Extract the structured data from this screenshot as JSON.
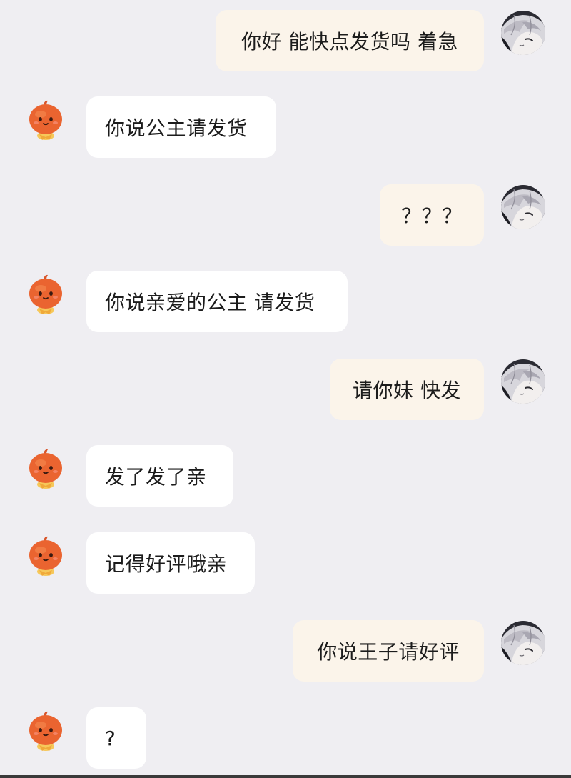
{
  "conversation": {
    "messages": [
      {
        "from": "customer",
        "text": "你好  能快点发货吗  着急",
        "avatar_icon": "anime-girl-avatar-icon"
      },
      {
        "from": "shop",
        "text": "你说公主请发货",
        "avatar_icon": "pumpkin-mascot-icon"
      },
      {
        "from": "customer",
        "text": "？？？",
        "avatar_icon": "anime-girl-avatar-icon"
      },
      {
        "from": "shop",
        "text": "你说亲爱的公主  请发货",
        "avatar_icon": "pumpkin-mascot-icon"
      },
      {
        "from": "customer",
        "text": "请你妹  快发",
        "avatar_icon": "anime-girl-avatar-icon"
      },
      {
        "from": "shop",
        "text": "发了发了亲",
        "avatar_icon": "pumpkin-mascot-icon"
      },
      {
        "from": "shop",
        "text": "记得好评哦亲",
        "avatar_icon": "pumpkin-mascot-icon"
      },
      {
        "from": "customer",
        "text": "你说王子请好评",
        "avatar_icon": "anime-girl-avatar-icon"
      },
      {
        "from": "shop",
        "text": "?",
        "avatar_icon": "pumpkin-mascot-icon"
      }
    ]
  },
  "colors": {
    "background": "#efeef2",
    "incoming_bubble": "#ffffff",
    "outgoing_bubble": "#fbf4ea",
    "text": "#1c1c1c",
    "mascot_orange": "#e8622c"
  }
}
